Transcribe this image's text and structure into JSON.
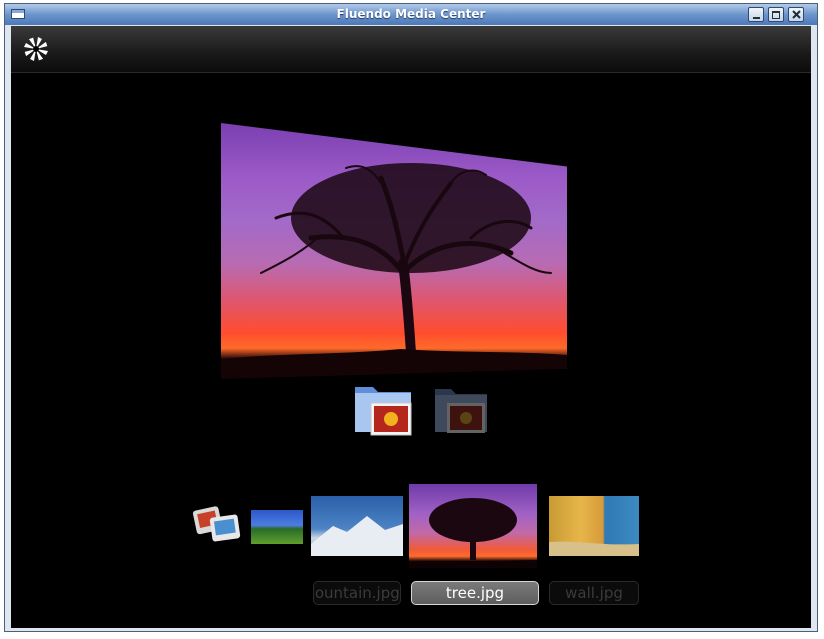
{
  "window": {
    "title": "Fluendo Media Center"
  },
  "toolbar": {
    "logo_icon": "fluendo-pinwheel-icon"
  },
  "viewer": {
    "current_image": "tree.jpg",
    "folders": [
      {
        "name": "pictures-folder",
        "state": "active"
      },
      {
        "name": "pictures-folder",
        "state": "inactive"
      }
    ]
  },
  "thumbnails": [
    {
      "name": "slideshow",
      "caption": ""
    },
    {
      "name": "landscape",
      "caption": ""
    },
    {
      "name": "mountain",
      "caption": "mountain.jpg"
    },
    {
      "name": "tree",
      "caption": "tree.jpg",
      "selected": true
    },
    {
      "name": "wall",
      "caption": "wall.jpg"
    }
  ],
  "colors": {
    "background": "#000000",
    "titlebar": "#6d95cc",
    "selected_caption_bg": "#6a6a6a"
  }
}
